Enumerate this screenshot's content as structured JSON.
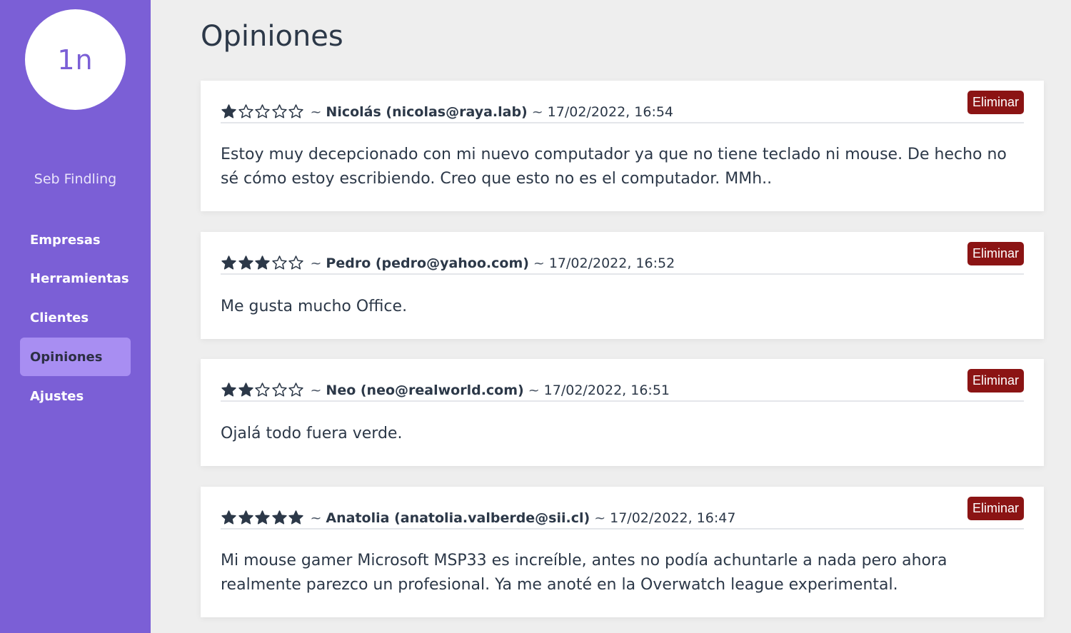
{
  "sidebar": {
    "logo_text": "1n",
    "username": "Seb Findling",
    "nav": [
      {
        "label": "Empresas",
        "active": false
      },
      {
        "label": "Herramientas",
        "active": false
      },
      {
        "label": "Clientes",
        "active": false
      },
      {
        "label": "Opiniones",
        "active": true
      },
      {
        "label": "Ajustes",
        "active": false
      }
    ]
  },
  "main": {
    "title": "Opiniones",
    "delete_label": "Eliminar",
    "separator": "~",
    "reviews": [
      {
        "rating": 1,
        "author": "Nicolás (nicolas@raya.lab)",
        "date": "17/02/2022, 16:54",
        "text": "Estoy muy decepcionado con mi nuevo computador ya que no tiene teclado ni mouse. De hecho no sé cómo estoy escribiendo. Creo que esto no es el computador. MMh.."
      },
      {
        "rating": 3,
        "author": "Pedro (pedro@yahoo.com)",
        "date": "17/02/2022, 16:52",
        "text": "Me gusta mucho Office."
      },
      {
        "rating": 2,
        "author": "Neo (neo@realworld.com)",
        "date": "17/02/2022, 16:51",
        "text": "Ojalá todo fuera verde."
      },
      {
        "rating": 5,
        "author": "Anatolia (anatolia.valberde@sii.cl)",
        "date": "17/02/2022, 16:47",
        "text": "Mi mouse gamer Microsoft MSP33 es increíble, antes no podía achuntarle a nada pero ahora realmente parezco un profesional. Ya me anoté en la Overwatch league experimental."
      }
    ],
    "max_rating": 5
  },
  "colors": {
    "sidebar_bg": "#7b5fd6",
    "nav_active_bg": "#a88ef2",
    "delete_btn_bg": "#8b1414",
    "star": "#2c3848"
  }
}
